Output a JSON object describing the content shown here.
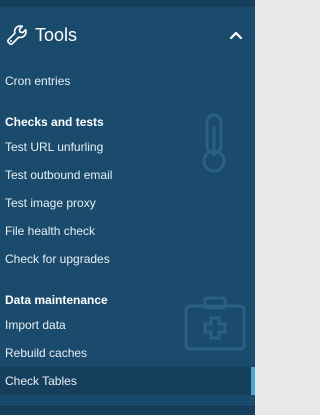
{
  "section": {
    "title": "Tools",
    "icon": "wrench-icon",
    "toggle_icon": "chevron-up-icon"
  },
  "menu": {
    "top_item": "Cron entries",
    "groups": [
      {
        "heading": "Checks and tests",
        "items": [
          "Test URL unfurling",
          "Test outbound email",
          "Test image proxy",
          "File health check",
          "Check for upgrades"
        ]
      },
      {
        "heading": "Data maintenance",
        "items": [
          "Import data",
          "Rebuild caches",
          "Check Tables"
        ]
      }
    ],
    "active_item": "Check Tables"
  },
  "colors": {
    "sidebar_bg": "#1a4a6c",
    "active_bg": "#163f5c",
    "active_indicator": "#4ca4d8",
    "text": "#e8f0f6",
    "page_bg": "#e9e9e9"
  }
}
